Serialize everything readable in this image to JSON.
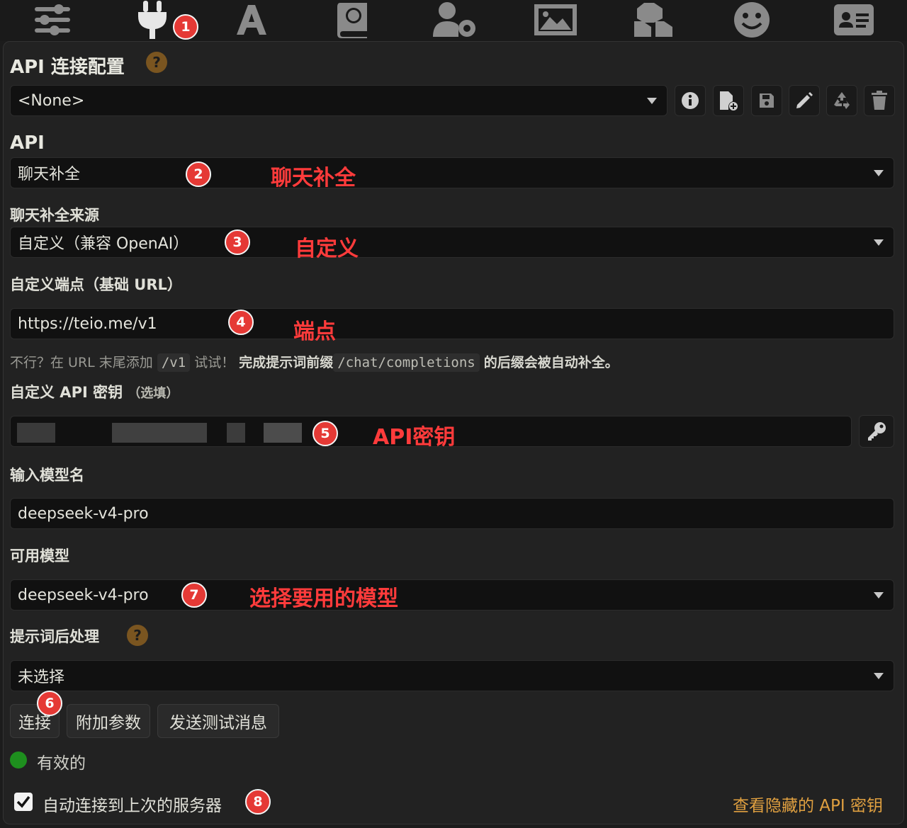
{
  "tabs": [
    {
      "icon": "sliders-icon"
    },
    {
      "icon": "plug-icon",
      "active": true
    },
    {
      "icon": "font-icon"
    },
    {
      "icon": "globe-book-icon"
    },
    {
      "icon": "user-gear-icon"
    },
    {
      "icon": "image-icon"
    },
    {
      "icon": "cubes-icon"
    },
    {
      "icon": "smile-icon"
    },
    {
      "icon": "id-card-icon"
    }
  ],
  "connection_profile": {
    "title": "API 连接配置",
    "help": "?",
    "selected": "<None>"
  },
  "api": {
    "label": "API",
    "value": "聊天补全"
  },
  "chat_source": {
    "label": "聊天补全来源",
    "value": "自定义（兼容 OpenAI）"
  },
  "endpoint": {
    "label": "自定义端点（基础 URL）",
    "value": "https://teio.me/v1"
  },
  "hint": {
    "part1": "不行？在 URL 末尾添加",
    "code1": "/v1",
    "part2": "试试！",
    "part3": "完成提示词前缀",
    "code2": "/chat/completions",
    "part4": "的后缀会被自动补全。"
  },
  "api_key": {
    "label": "自定义 API 密钥",
    "optional": "（选填）"
  },
  "model_input": {
    "label": "输入模型名",
    "value": "deepseek-v4-pro"
  },
  "available_models": {
    "label": "可用模型",
    "value": "deepseek-v4-pro"
  },
  "post_processing": {
    "label": "提示词后处理",
    "help": "?",
    "value": "未选择"
  },
  "buttons": {
    "connect": "连接",
    "extra_params": "附加参数",
    "send_test": "发送测试消息"
  },
  "status": {
    "text": "有效的",
    "color": "#1e8f1e"
  },
  "auto_connect": {
    "label": "自动连接到上次的服务器",
    "checked": true
  },
  "reveal_link": "查看隐藏的 API 密钥",
  "annotations": {
    "badges": [
      "1",
      "2",
      "3",
      "4",
      "5",
      "6",
      "7",
      "8"
    ],
    "notes": {
      "api": "聊天补全",
      "source": "自定义",
      "endpoint": "端点",
      "key": "API密钥",
      "model": "选择要用的模型"
    },
    "badge_color": "#e53935",
    "note_color": "#ff3b3b"
  }
}
